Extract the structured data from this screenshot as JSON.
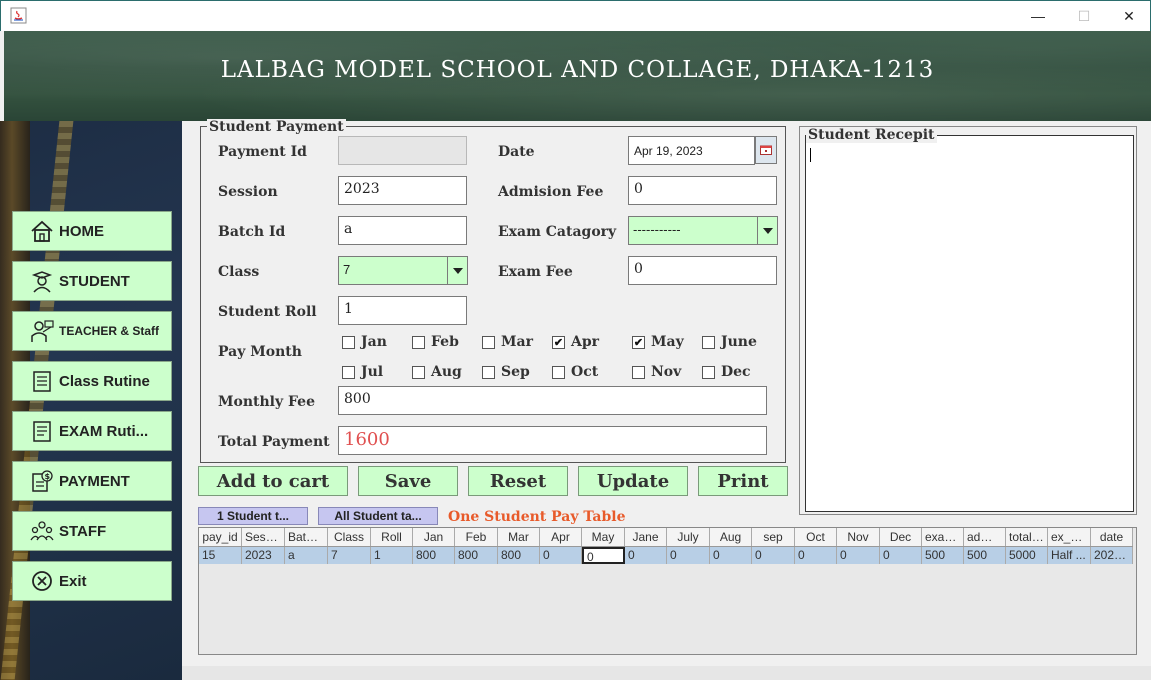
{
  "banner": {
    "title": "LALBAG MODEL SCHOOL AND COLLAGE, DHAKA-1213"
  },
  "window": {
    "minimize": "—",
    "maximize": "☐",
    "close": "✕"
  },
  "sidebar": {
    "items": [
      {
        "label": "HOME",
        "icon": "home-icon"
      },
      {
        "label": "STUDENT",
        "icon": "student-icon"
      },
      {
        "label": "TEACHER & Staff",
        "icon": "teacher-icon"
      },
      {
        "label": "Class Rutine",
        "icon": "routine-icon"
      },
      {
        "label": "EXAM Ruti...",
        "icon": "exam-routine-icon"
      },
      {
        "label": "PAYMENT",
        "icon": "payment-icon"
      },
      {
        "label": "STAFF",
        "icon": "staff-icon"
      },
      {
        "label": "Exit",
        "icon": "exit-icon"
      }
    ]
  },
  "form": {
    "group_title": "Student Payment",
    "payment_id_label": "Payment Id",
    "payment_id_value": "",
    "session_label": "Session",
    "session_value": "2023",
    "batch_label": "Batch Id",
    "batch_value": "a",
    "class_label": "Class",
    "class_value": "7",
    "roll_label": "Student Roll",
    "roll_value": "1",
    "paymonth_label": "Pay Month",
    "monthly_fee_label": "Monthly Fee",
    "monthly_fee_value": "800",
    "total_label": "Total Payment",
    "total_value": "1600",
    "date_label": "Date",
    "date_value": "Apr 19, 2023",
    "admission_label": "Admision Fee",
    "admission_value": "0",
    "exam_cat_label": "Exam Catagory",
    "exam_cat_value": "-----------",
    "exam_fee_label": "Exam Fee",
    "exam_fee_value": "0"
  },
  "months": [
    {
      "label": "Jan",
      "checked": false
    },
    {
      "label": "Feb",
      "checked": false
    },
    {
      "label": "Mar",
      "checked": false
    },
    {
      "label": "Apr",
      "checked": true
    },
    {
      "label": "May",
      "checked": true
    },
    {
      "label": "June",
      "checked": false
    },
    {
      "label": "Jul",
      "checked": false
    },
    {
      "label": "Aug",
      "checked": false
    },
    {
      "label": "Sep",
      "checked": false
    },
    {
      "label": "Oct",
      "checked": false
    },
    {
      "label": "Nov",
      "checked": false
    },
    {
      "label": "Dec",
      "checked": false
    }
  ],
  "actions": {
    "add": "Add to cart",
    "save": "Save",
    "reset": "Reset",
    "update": "Update",
    "print": "Print"
  },
  "receipt": {
    "title": "Student Recepit"
  },
  "tabs": {
    "one": "1 Student t...",
    "all": "All Student ta...",
    "caption": "One Student Pay Table"
  },
  "table": {
    "headers": [
      "pay_id",
      "Sessi...",
      "Batch...",
      "Class",
      "Roll",
      "Jan",
      "Feb",
      "Mar",
      "Apr",
      "May",
      "Jane",
      "July",
      "Aug",
      "sep",
      "Oct",
      "Nov",
      "Dec",
      "exam...",
      "admi...",
      "totalP...",
      "ex_ca...",
      "date"
    ],
    "rows": [
      [
        "15",
        "2023",
        "a",
        "7",
        "1",
        "800",
        "800",
        "800",
        "0",
        "0",
        "0",
        "0",
        "0",
        "0",
        "0",
        "0",
        "0",
        "500",
        "500",
        "5000",
        "Half ...",
        "2023..."
      ]
    ]
  },
  "colors": {
    "accent_green": "#ccffcc",
    "total_red": "#e05050",
    "caption_orange": "#e85a2a"
  }
}
